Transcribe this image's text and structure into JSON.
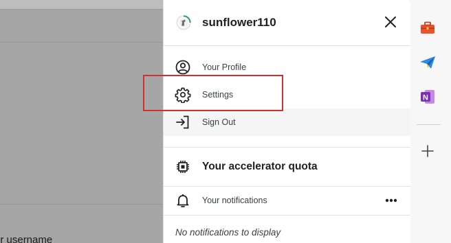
{
  "background": {
    "partial_text": "ur username"
  },
  "account": {
    "username": "sunflower110"
  },
  "menu": {
    "items": [
      {
        "label": "Your Profile",
        "icon": "user-circle-icon"
      },
      {
        "label": "Settings",
        "icon": "gear-icon"
      },
      {
        "label": "Sign Out",
        "icon": "sign-out-icon"
      }
    ]
  },
  "quota": {
    "label": "Your accelerator quota",
    "icon": "chip-icon"
  },
  "notifications": {
    "label": "Your notifications",
    "icon": "bell-icon",
    "empty_text": "No notifications to display"
  },
  "sidebar": {
    "items": [
      {
        "icon": "toolbox-icon",
        "color": "#e8542e"
      },
      {
        "icon": "paper-plane-icon",
        "color": "#2b8ae6"
      },
      {
        "icon": "onenote-icon",
        "color": "#7b2fb5"
      },
      {
        "icon": "plus-icon",
        "color": "#444444"
      }
    ]
  },
  "colors": {
    "highlight": "#d32f2f",
    "avatar_ring": "#20a35a"
  }
}
